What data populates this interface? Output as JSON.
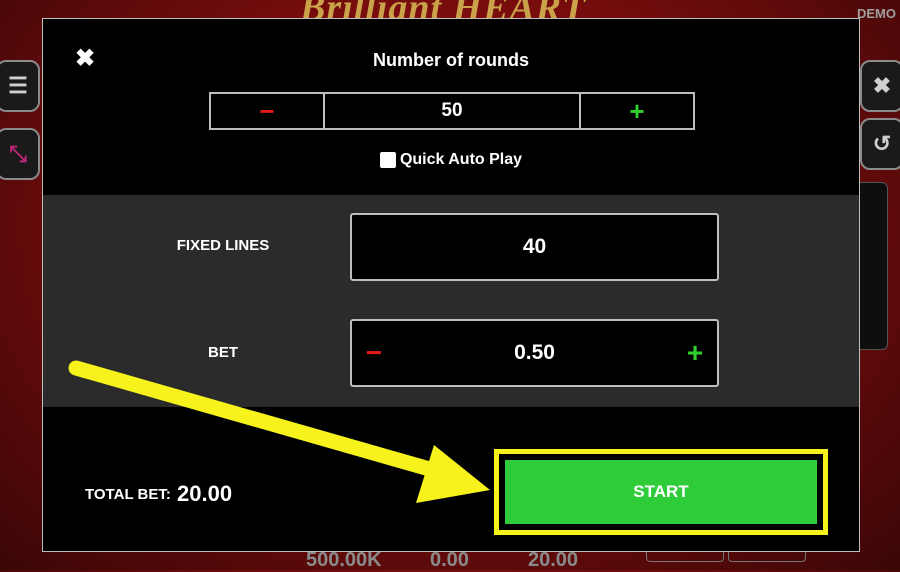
{
  "background": {
    "game_title": "Brilliant HEART",
    "demo_label": "DEMO",
    "bottom_stats": [
      "500.00K",
      "0.00",
      "20.00"
    ]
  },
  "modal": {
    "rounds": {
      "title": "Number of rounds",
      "value": "50",
      "minus_label": "−",
      "plus_label": "+"
    },
    "quick_auto_play": {
      "label": "Quick Auto Play",
      "checked": false
    },
    "fixed_lines": {
      "label": "FIXED LINES",
      "value": "40"
    },
    "bet": {
      "label": "BET",
      "value": "0.50",
      "minus_label": "−",
      "plus_label": "+"
    },
    "total_bet": {
      "label": "TOTAL BET:",
      "value": "20.00"
    },
    "start_label": "START",
    "close_label": "✖"
  },
  "icons": [
    "menu-icon",
    "fullscreen-icon",
    "close-icon",
    "history-icon",
    "arrow-annotation"
  ],
  "colors": {
    "start_green": "#2fcc3a",
    "highlight_yellow": "#f7f21b",
    "minus_red": "#e61919",
    "plus_green": "#2fd12f"
  }
}
